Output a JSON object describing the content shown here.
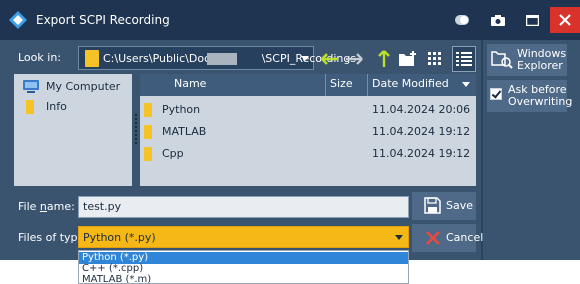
{
  "window": {
    "title": "Export SCPI Recording"
  },
  "look_in": {
    "label": "Look in:",
    "path_prefix": "C:\\Users\\Public\\Docu...",
    "path_suffix": "\\SCPI_Recordings"
  },
  "places": [
    {
      "label": "My Computer",
      "icon": "computer-icon"
    },
    {
      "label": "Info",
      "icon": "folder-icon"
    }
  ],
  "columns": [
    "Name",
    "Size",
    "Date Modified"
  ],
  "files": [
    {
      "name": "Python",
      "size": "",
      "date": "11.04.2024 20:06"
    },
    {
      "name": "MATLAB",
      "size": "",
      "date": "11.04.2024 19:12"
    },
    {
      "name": "Cpp",
      "size": "",
      "date": "11.04.2024 19:12"
    }
  ],
  "side": {
    "windows_explorer": "Windows Explorer",
    "windows_explorer_l1": "Windows",
    "windows_explorer_l2": "Explorer",
    "ask_before_l1": "Ask before",
    "ask_before_l2": "Overwriting",
    "ask_before_checked": true
  },
  "file_name": {
    "label": "File name:",
    "value": "test.py"
  },
  "file_type": {
    "label": "Files of type:",
    "selected": "Python (*.py)",
    "options": [
      "Python (*.py)",
      "C++ (*.cpp)",
      "MATLAB (*.m)"
    ]
  },
  "buttons": {
    "save": "Save",
    "cancel": "Cancel"
  },
  "colors": {
    "title_bar": "#1e3450",
    "dialog_bg": "#3a5470",
    "accent": "#f6b817",
    "close": "#d8322a",
    "selection": "#2f86d8"
  }
}
